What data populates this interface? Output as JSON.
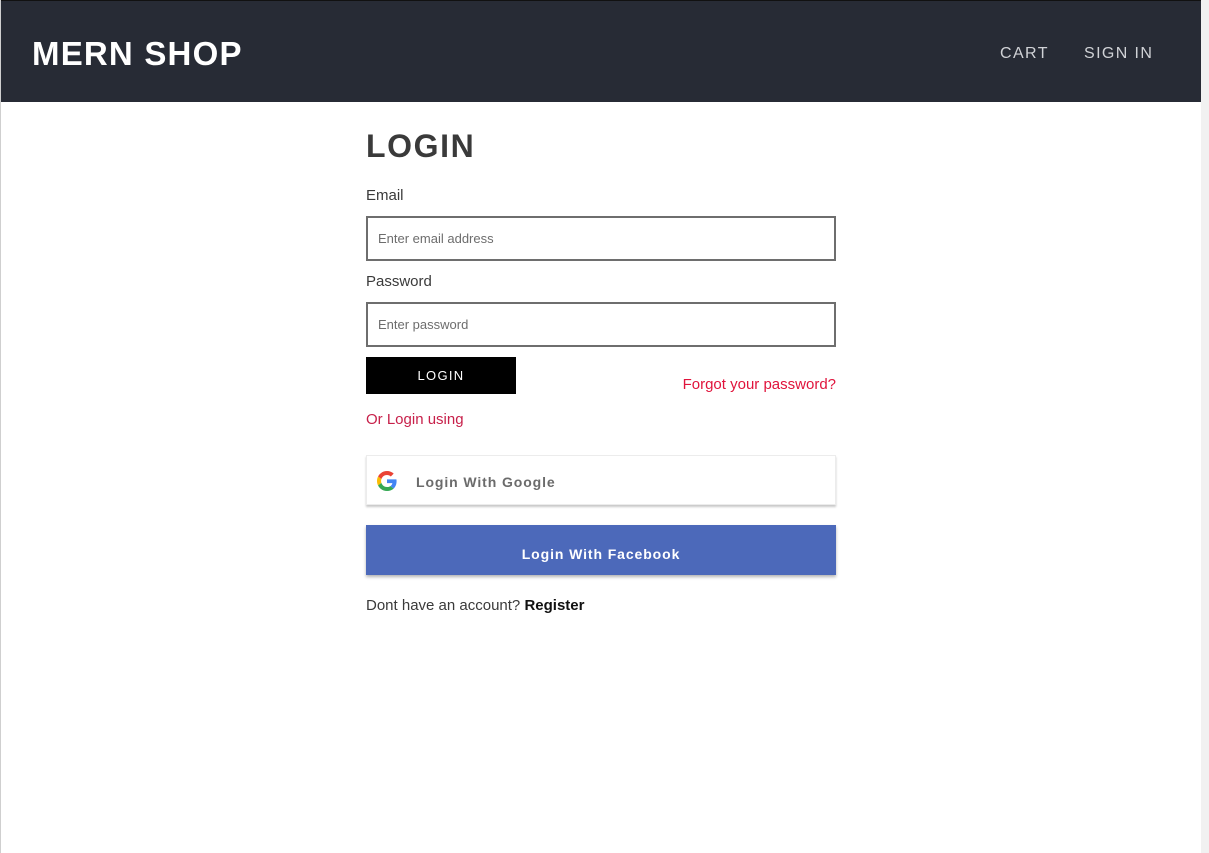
{
  "navbar": {
    "brand": "MERN SHOP",
    "links": {
      "cart": "CART",
      "sign_in": "SIGN IN"
    },
    "background_color": "#272b35"
  },
  "login_form": {
    "title": "LOGIN",
    "email": {
      "label": "Email",
      "value": "",
      "placeholder": "Enter email address"
    },
    "password": {
      "label": "Password",
      "value": "",
      "placeholder": "Enter password"
    },
    "submit_label": "LOGIN",
    "forgot_password_label": "Forgot your password?",
    "or_login_using": "Or Login using",
    "google_button_label": "Login With Google",
    "google_icon": "google-g-icon",
    "facebook_button_label": "Login With Facebook",
    "facebook_color": "#4c69ba",
    "accent_color": "#e0143c",
    "register_prompt": "Dont have an account?",
    "register_link": "Register"
  }
}
